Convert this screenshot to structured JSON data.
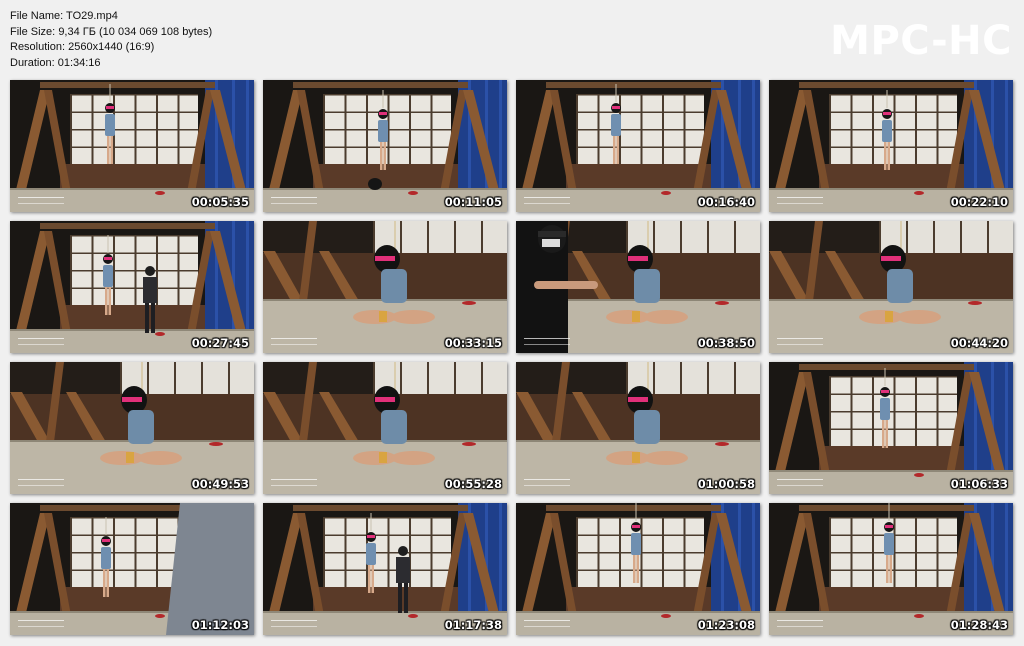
{
  "file_info": {
    "name_label": "File Name:",
    "name_value": "TO29.mp4",
    "size_label": "File Size:",
    "size_value": "9,34 ГБ (10 034 069 108 bytes)",
    "resolution_label": "Resolution:",
    "resolution_value": "2560x1440 (16:9)",
    "duration_label": "Duration:",
    "duration_value": "01:34:16"
  },
  "brand": "MPC-HC",
  "thumbnails": [
    {
      "time": "00:05:35",
      "scene": "wide-standing"
    },
    {
      "time": "00:11:05",
      "scene": "wide-standing-bag"
    },
    {
      "time": "00:16:40",
      "scene": "wide-standing"
    },
    {
      "time": "00:22:10",
      "scene": "wide-standing-right"
    },
    {
      "time": "00:27:45",
      "scene": "wide-two-people"
    },
    {
      "time": "00:33:15",
      "scene": "close-seated"
    },
    {
      "time": "00:38:50",
      "scene": "close-seated-person"
    },
    {
      "time": "00:44:20",
      "scene": "close-seated"
    },
    {
      "time": "00:49:53",
      "scene": "close-seated"
    },
    {
      "time": "00:55:28",
      "scene": "close-seated"
    },
    {
      "time": "01:00:58",
      "scene": "close-seated"
    },
    {
      "time": "01:06:33",
      "scene": "wide-standing-center"
    },
    {
      "time": "01:12:03",
      "scene": "wide-standing-occluded"
    },
    {
      "time": "01:17:38",
      "scene": "wide-two-people-center"
    },
    {
      "time": "01:23:08",
      "scene": "wide-suspended"
    },
    {
      "time": "01:28:43",
      "scene": "wide-suspended"
    }
  ]
}
